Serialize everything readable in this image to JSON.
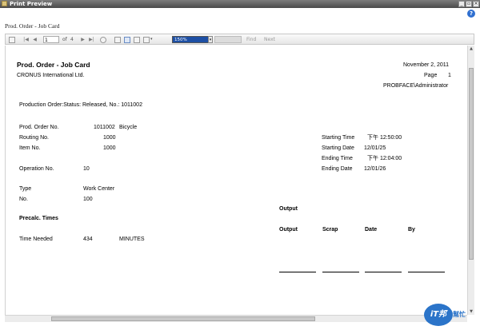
{
  "window": {
    "title": "Print Preview",
    "minimize": "_",
    "restore": "▫",
    "close": "×"
  },
  "help_icon_glyph": "?",
  "document_title": "Prod. Order - Job Card",
  "toolbar": {
    "first_glyph": "|◀",
    "prev_glyph": "◀",
    "next_glyph": "▶",
    "last_glyph": "▶|",
    "page_value": "1",
    "of_label": "of",
    "page_count": "4",
    "zoom_value": "150%",
    "zoom_arrow": "▾",
    "find_label": "Find",
    "next_label": "Next"
  },
  "report": {
    "title": "Prod. Order - Job Card",
    "company": "CRONUS International Ltd.",
    "date": "November 2, 2011",
    "page_label": "Page",
    "page_number": "1",
    "user": "PROBFACE\\Administrator",
    "filter": "Production Order:Status: Released, No.: 1011002",
    "fields_left": [
      {
        "label": "Prod. Order No.",
        "value": "1011002",
        "extra": "Bicycle"
      },
      {
        "label": "Routing No.",
        "value": "1000"
      },
      {
        "label": "Item No.",
        "value": "1000"
      }
    ],
    "operation_no_label": "Operation No.",
    "operation_no_value": "10",
    "type_label": "Type",
    "type_value": "Work Center",
    "no_label": "No.",
    "no_value": "100",
    "fields_right": [
      {
        "label": "Starting Time",
        "value": "下午 12:50:00"
      },
      {
        "label": "Starting Date",
        "value": "12/01/25"
      },
      {
        "label": "Ending Time",
        "value": "下午 12:04:00"
      },
      {
        "label": "Ending Date",
        "value": "12/01/26"
      }
    ],
    "output_section_label": "Output",
    "precalc_label": "Precalc. Times",
    "columns": [
      "Output",
      "Scrap",
      "Date",
      "By"
    ],
    "time_needed_label": "Time Needed",
    "time_needed_value": "434",
    "time_needed_unit": "MINUTES"
  },
  "watermark": {
    "logo_text": "iT邦",
    "suffix": "幫忙"
  }
}
